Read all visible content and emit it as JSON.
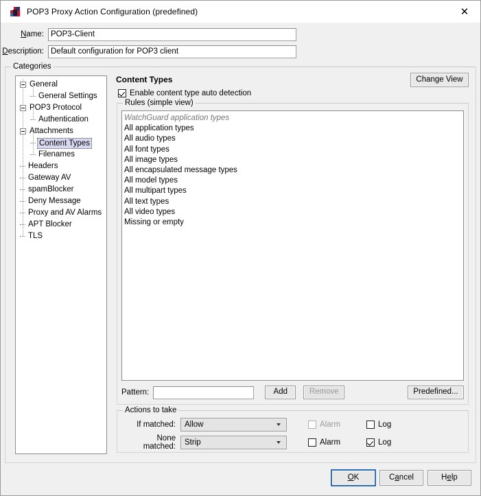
{
  "window": {
    "title": "POP3 Proxy Action Configuration (predefined)",
    "icon": "watchguard-logo-icon",
    "close_label": "✕"
  },
  "header": {
    "name_label_pre": "N",
    "name_label_mnemonic": "N",
    "name_label": "Name:",
    "name_value": "POP3-Client",
    "description_label": "Description:",
    "description_value": "Default configuration for POP3 client"
  },
  "categories": {
    "group_label": "Categories",
    "tree": [
      {
        "label": "General",
        "level": 0,
        "expander": true,
        "selected": false
      },
      {
        "label": "General Settings",
        "level": 1,
        "expander": false,
        "selected": false
      },
      {
        "label": "POP3 Protocol",
        "level": 0,
        "expander": true,
        "selected": false
      },
      {
        "label": "Authentication",
        "level": 1,
        "expander": false,
        "selected": false
      },
      {
        "label": "Attachments",
        "level": 0,
        "expander": true,
        "selected": false
      },
      {
        "label": "Content Types",
        "level": 1,
        "expander": false,
        "selected": true
      },
      {
        "label": "Filenames",
        "level": 1,
        "expander": false,
        "selected": false
      },
      {
        "label": "Headers",
        "level": 0,
        "expander": false,
        "selected": false
      },
      {
        "label": "Gateway AV",
        "level": 0,
        "expander": false,
        "selected": false
      },
      {
        "label": "spamBlocker",
        "level": 0,
        "expander": false,
        "selected": false
      },
      {
        "label": "Deny Message",
        "level": 0,
        "expander": false,
        "selected": false
      },
      {
        "label": "Proxy and AV Alarms",
        "level": 0,
        "expander": false,
        "selected": false
      },
      {
        "label": "APT Blocker",
        "level": 0,
        "expander": false,
        "selected": false
      },
      {
        "label": "TLS",
        "level": 0,
        "expander": false,
        "selected": false
      }
    ]
  },
  "content": {
    "title": "Content Types",
    "change_view_label": "Change View",
    "auto_detect_label": "Enable content type auto detection",
    "auto_detect_checked": true,
    "rules_group_label": "Rules (simple view)",
    "rules": [
      {
        "text": "WatchGuard application types",
        "style": "italic"
      },
      {
        "text": "All application types",
        "style": "normal"
      },
      {
        "text": "All audio types",
        "style": "normal"
      },
      {
        "text": "All font types",
        "style": "normal"
      },
      {
        "text": "All image types",
        "style": "normal"
      },
      {
        "text": "All encapsulated message types",
        "style": "normal"
      },
      {
        "text": "All model types",
        "style": "normal"
      },
      {
        "text": "All multipart types",
        "style": "normal"
      },
      {
        "text": "All text types",
        "style": "normal"
      },
      {
        "text": "All video types",
        "style": "normal"
      },
      {
        "text": "Missing or empty",
        "style": "normal"
      }
    ],
    "pattern_label": "Pattern:",
    "pattern_value": "",
    "pattern_placeholder": "",
    "add_label": "Add",
    "remove_label": "Remove",
    "remove_disabled": true,
    "predefined_label": "Predefined..."
  },
  "actions": {
    "group_label": "Actions to take",
    "rows": [
      {
        "label": "If matched:",
        "value": "Allow",
        "alarm_label": "Alarm",
        "alarm_checked": false,
        "alarm_disabled": true,
        "log_label": "Log",
        "log_checked": false,
        "log_disabled": false
      },
      {
        "label": "None matched:",
        "value": "Strip",
        "alarm_label": "Alarm",
        "alarm_checked": false,
        "alarm_disabled": false,
        "log_label": "Log",
        "log_checked": true,
        "log_disabled": false
      }
    ]
  },
  "footer": {
    "ok_label": "OK",
    "cancel_label": "Cancel",
    "help_label": "Help"
  },
  "colors": {
    "window_bg": "#f0f0f0",
    "selection_bg": "#d7d7ef",
    "focus_blue": "#2b6bbf",
    "italic_gray": "#767676",
    "disabled_gray": "#9a9a9a"
  }
}
